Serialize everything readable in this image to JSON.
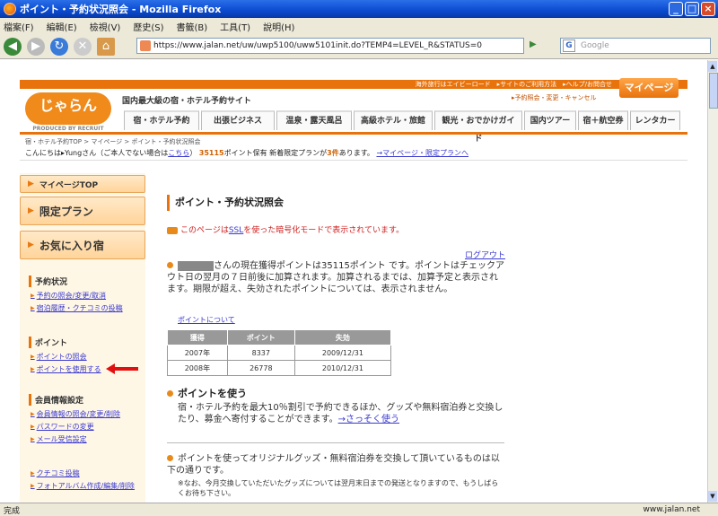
{
  "window": {
    "title": "ポイント・予約状況照会 - Mozilla Firefox"
  },
  "menu": [
    "檔案(F)",
    "編輯(E)",
    "檢視(V)",
    "歷史(S)",
    "書籤(B)",
    "工具(T)",
    "說明(H)"
  ],
  "nav": {
    "url": "https://www.jalan.net/uw/uwp5100/uww5101init.do?TEMP4=LEVEL_R&STATUS=0",
    "search_placeholder": "Google"
  },
  "site": {
    "logo": "じゃらん",
    "logo_sub": "PRODUCED BY RECRUIT",
    "top_strip": "海外旅行はエイビーロード　▸サイトのご利用方法　▸ヘルプ/お問合せ",
    "tagline": "国内最大級の宿・ホテル予約サイト",
    "top_link": "▸予約照会・変更・キャンセル",
    "mypage_button": "マイページ",
    "tabs": [
      "宿・ホテル予約",
      "出張ビジネス",
      "温泉・露天風呂",
      "高級ホテル・旅館",
      "観光・おでかけガイド",
      "国内ツアー",
      "宿＋航空券",
      "レンタカー"
    ]
  },
  "breadcrumb": "宿・ホテル予約TOP > マイページ > ポイント・予約状況照会",
  "greeting": {
    "prefix": "こんにちは▸",
    "user": "Yung",
    "mid": "さん（ご本人でない場合は",
    "here": "こちら",
    "close": "）",
    "points": "35115",
    "points_text": "ポイント保有 新着限定プランが",
    "count": "3件",
    "count_text": "あります。",
    "link": "→マイページ・限定プランへ"
  },
  "sidebar": {
    "buttons": [
      "マイページTOP",
      "限定プラン",
      "お気に入り宿"
    ],
    "sections": [
      {
        "heading": "予約状況",
        "links": [
          "予約の照会/変更/取消",
          "宿泊履歴・クチコミの投稿"
        ]
      },
      {
        "heading": "ポイント",
        "links": [
          "ポイントの照会",
          "ポイントを使用する"
        ]
      },
      {
        "heading": "会員情報設定",
        "links": [
          "会員情報の照会/変更/削除",
          "パスワードの変更",
          "メール受信設定"
        ]
      },
      {
        "heading": "",
        "links": [
          "クチコミ投稿",
          "フォトアルバム作成/編集/削除"
        ]
      }
    ]
  },
  "main": {
    "title": "ポイント・予約状況照会",
    "ssl_pre": "このページは",
    "ssl_link": "SSL",
    "ssl_post": "を使った暗号化モードで表示されています。",
    "logout": "ログアウト",
    "point_info": "さんの現在獲得ポイントは35115ポイント です。ポイントはチェックアウト日の翌月の７日前後に加算されます。加算されるまでは、加算予定と表示されます。期限が超え、失効されたポイントについては、表示されません。",
    "point_link": "ポイントについて",
    "table": {
      "headers": [
        "獲得",
        "ポイント",
        "失効"
      ],
      "rows": [
        [
          "2007年",
          "8337",
          "2009/12/31"
        ],
        [
          "2008年",
          "26778",
          "2010/12/31"
        ]
      ]
    },
    "use_heading": "ポイントを使う",
    "use_text": "宿・ホテル予約を最大10％割引で予約できるほか、グッズや無料宿泊券と交換したり、募金へ寄付することができます。",
    "use_link": "→さっそく使う",
    "goods_text": "ポイントを使ってオリジナルグッズ・無料宿泊券を交換して頂いているものは以下の通りです。",
    "goods_note": "※なお、今月交換していただいたグッズについては翌月末日までの発送となりますので、もうしばらくお待ち下さい。"
  },
  "status": {
    "left": "完成",
    "right": "www.jalan.net"
  }
}
